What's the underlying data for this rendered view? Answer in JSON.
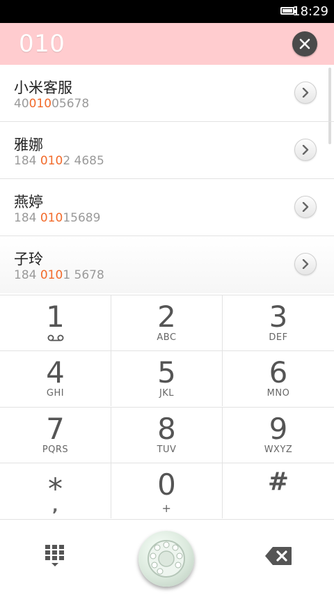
{
  "status_bar": {
    "time": "18:29",
    "battery_icon": "battery-icon"
  },
  "search": {
    "query": "010",
    "clear_icon": "close-icon"
  },
  "results": [
    {
      "name": "小米客服",
      "number_pre": "40",
      "number_match": "010",
      "number_post": "05678"
    },
    {
      "name": "雅娜",
      "number_pre": "184 ",
      "number_match": "010",
      "number_post": "2 4685"
    },
    {
      "name": "燕婷",
      "number_pre": "184 ",
      "number_match": "010",
      "number_post": "15689"
    },
    {
      "name": "子玲",
      "number_pre": "184 ",
      "number_match": "010",
      "number_post": "1 5678"
    }
  ],
  "keypad": {
    "keys": [
      {
        "digit": "1",
        "letters": ""
      },
      {
        "digit": "2",
        "letters": "ABC"
      },
      {
        "digit": "3",
        "letters": "DEF"
      },
      {
        "digit": "4",
        "letters": "GHI"
      },
      {
        "digit": "5",
        "letters": "JKL"
      },
      {
        "digit": "6",
        "letters": "MNO"
      },
      {
        "digit": "7",
        "letters": "PQRS"
      },
      {
        "digit": "8",
        "letters": "TUV"
      },
      {
        "digit": "9",
        "letters": "WXYZ"
      },
      {
        "digit": "*",
        "letters": ","
      },
      {
        "digit": "0",
        "letters": "+"
      },
      {
        "digit": "#",
        "letters": ""
      }
    ]
  },
  "bottom_bar": {
    "left_icon": "dialpad-toggle-icon",
    "call_icon": "rotary-phone-icon",
    "right_icon": "backspace-icon"
  },
  "colors": {
    "search_bar_bg": "#ffcccf",
    "match_highlight": "#f26a2a",
    "status_bar_bg": "#000000"
  }
}
